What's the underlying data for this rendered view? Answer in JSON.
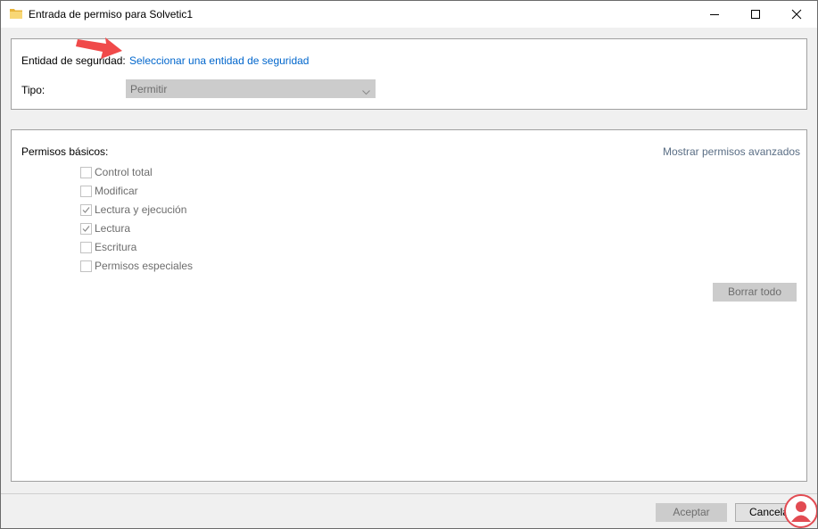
{
  "window": {
    "title": "Entrada de permiso para Solvetic1",
    "controls": [
      "minimize-icon",
      "maximize-icon",
      "close-icon"
    ]
  },
  "principal": {
    "label": "Entidad de seguridad:",
    "link": "Seleccionar una entidad de seguridad"
  },
  "type": {
    "label": "Tipo:",
    "value": "Permitir"
  },
  "permissions": {
    "heading": "Permisos básicos:",
    "advanced_link": "Mostrar permisos avanzados",
    "items": [
      {
        "label": "Control total",
        "checked": false
      },
      {
        "label": "Modificar",
        "checked": false
      },
      {
        "label": "Lectura y ejecución",
        "checked": true
      },
      {
        "label": "Lectura",
        "checked": true
      },
      {
        "label": "Escritura",
        "checked": false
      },
      {
        "label": "Permisos especiales",
        "checked": false
      }
    ],
    "clear_all": "Borrar todo"
  },
  "footer": {
    "ok": "Aceptar",
    "cancel": "Cancelar"
  },
  "colors": {
    "link": "#0066cc",
    "annotation_arrow": "#f04a4a",
    "disabled_bg": "#cccccc",
    "disabled_text": "#6d6d6d"
  }
}
